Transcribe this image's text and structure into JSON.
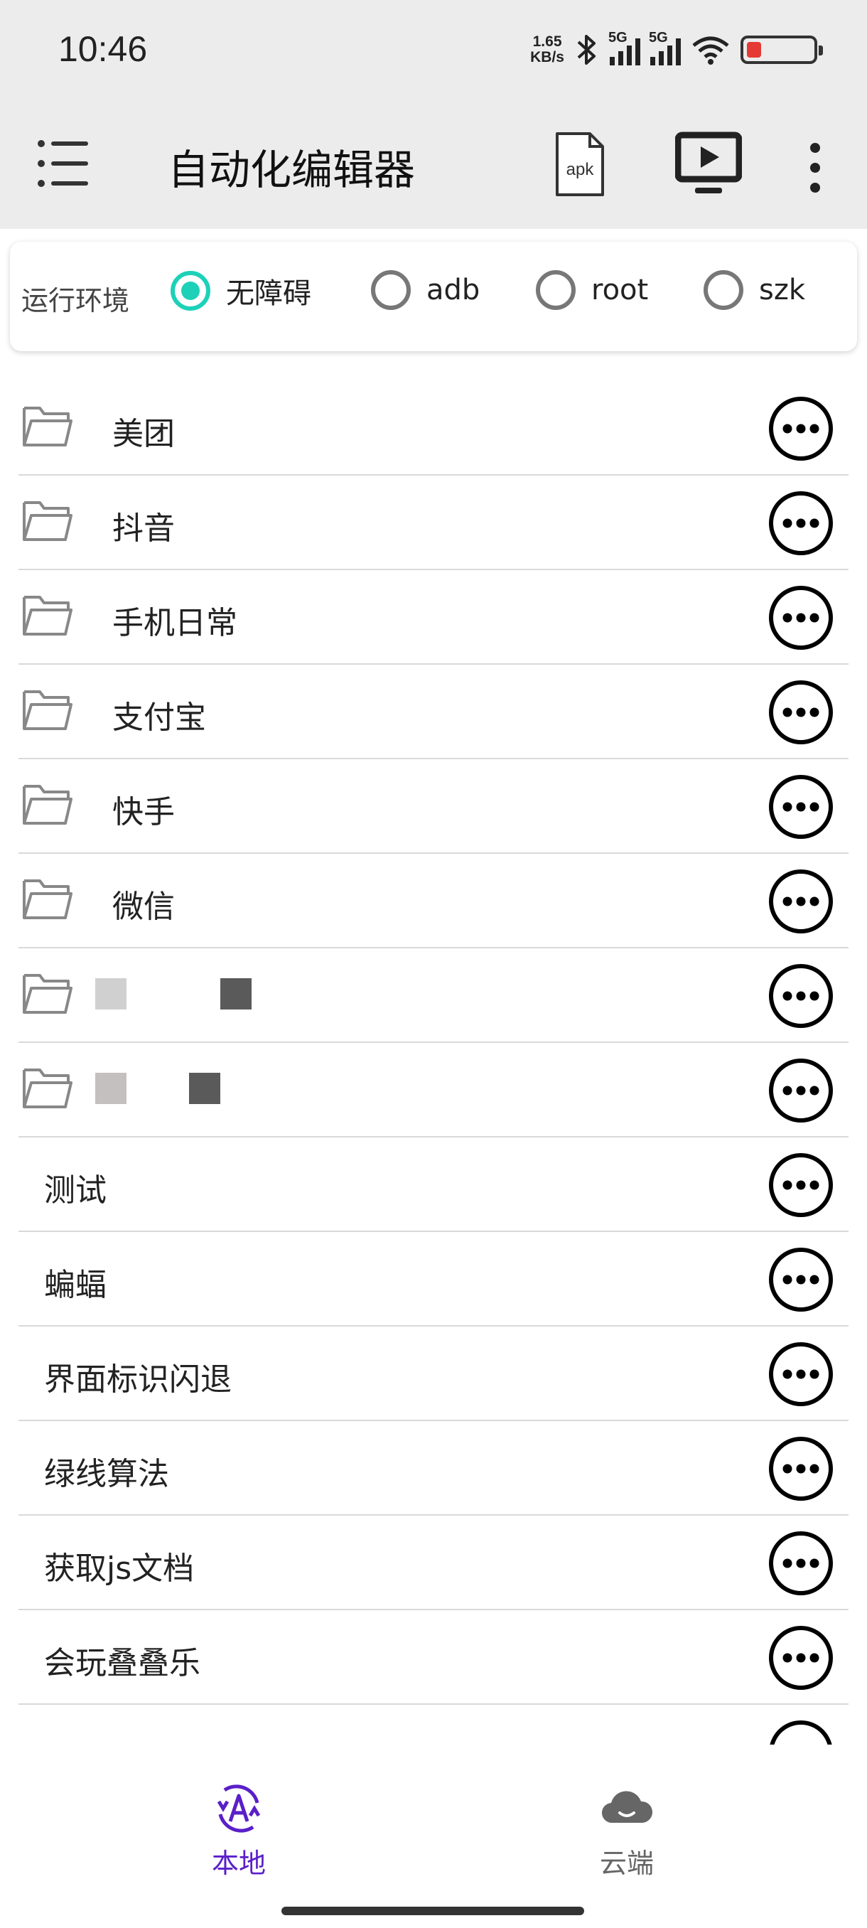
{
  "status_bar": {
    "time": "10:46",
    "net_speed_value": "1.65",
    "net_speed_unit": "KB/s",
    "sim1_label": "5G",
    "sim2_label": "5G",
    "battery_color": "#e53935"
  },
  "app_bar": {
    "title": "自动化编辑器",
    "apk_label": "apk"
  },
  "run_env": {
    "label": "运行环境",
    "options": [
      "无障碍",
      "adb",
      "root",
      "szk"
    ],
    "selected": "无障碍",
    "accent": "#1dd1b8"
  },
  "list": {
    "folders": [
      "美团",
      "抖音",
      "手机日常",
      "支付宝",
      "快手",
      "微信"
    ],
    "files": [
      "测试",
      "蝙蝠",
      "界面标识闪退",
      "绿线算法",
      "获取js文档",
      "会玩叠叠乐"
    ]
  },
  "bottom_nav": {
    "items": [
      {
        "label": "本地",
        "active": true,
        "icon": "local-a-icon"
      },
      {
        "label": "云端",
        "active": false,
        "icon": "cloud-icon"
      }
    ],
    "active_color": "#5a1fc9"
  }
}
